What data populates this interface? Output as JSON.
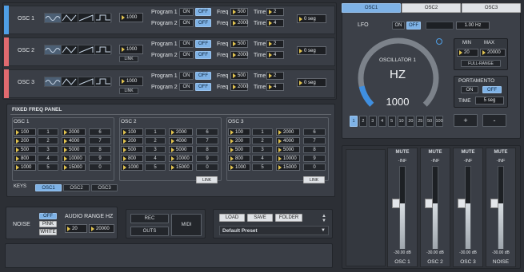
{
  "osc_rows": [
    {
      "label": "OSC 1",
      "accent": "#4f9fe6",
      "freq_value": "1000",
      "link": "",
      "prog1": "Program 1",
      "prog2": "Program 2",
      "on": "ON",
      "off": "OFF",
      "freq_label": "Freq",
      "time_label": "Time",
      "freq1": "500",
      "freq2": "2000",
      "time1": "2",
      "time2": "4",
      "seg": "0 seg"
    },
    {
      "label": "OSC 2",
      "accent": "#e06a6f",
      "freq_value": "1000",
      "link": "LINK",
      "prog1": "Program 1",
      "prog2": "Program 2",
      "on": "ON",
      "off": "OFF",
      "freq_label": "Freq",
      "time_label": "Time",
      "freq1": "500",
      "freq2": "2000",
      "time1": "2",
      "time2": "4",
      "seg": "0 seg"
    },
    {
      "label": "OSC 3",
      "accent": "#e06a6f",
      "freq_value": "1000",
      "link": "LINK",
      "prog1": "Program 1",
      "prog2": "Program 2",
      "on": "ON",
      "off": "OFF",
      "freq_label": "Freq",
      "time_label": "Time",
      "freq1": "500",
      "freq2": "2000",
      "time1": "2",
      "time2": "4",
      "seg": "0 seg"
    }
  ],
  "fixed_panel": {
    "title": "FIXED FREQ PANEL",
    "groups": [
      {
        "label": "OSC 1",
        "rows": [
          [
            "100",
            "1",
            "2000",
            "6"
          ],
          [
            "200",
            "2",
            "4000",
            "7"
          ],
          [
            "500",
            "3",
            "5000",
            "8"
          ],
          [
            "800",
            "4",
            "10000",
            "9"
          ],
          [
            "1000",
            "5",
            "15000",
            "0"
          ]
        ],
        "link": ""
      },
      {
        "label": "OSC 2",
        "rows": [
          [
            "100",
            "1",
            "2000",
            "6"
          ],
          [
            "200",
            "2",
            "4000",
            "7"
          ],
          [
            "500",
            "3",
            "5000",
            "8"
          ],
          [
            "800",
            "4",
            "10000",
            "9"
          ],
          [
            "1000",
            "5",
            "15000",
            "0"
          ]
        ],
        "link": "LINK"
      },
      {
        "label": "OSC 3",
        "rows": [
          [
            "100",
            "1",
            "2000",
            "6"
          ],
          [
            "200",
            "2",
            "4000",
            "7"
          ],
          [
            "500",
            "3",
            "5000",
            "8"
          ],
          [
            "800",
            "4",
            "10000",
            "9"
          ],
          [
            "1000",
            "5",
            "15000",
            "0"
          ]
        ],
        "link": "LINK"
      }
    ],
    "keys_label": "KEYS",
    "keys_tabs": [
      "OSC1",
      "OSC2",
      "OSC3"
    ]
  },
  "noise": {
    "label": "NOISE",
    "options": [
      "OFF",
      "PINK",
      "WHITE"
    ],
    "audio_range_label": "AUDIO RANGE HZ",
    "min": "20",
    "max": "20000"
  },
  "routing": {
    "rec": "REC",
    "outs": "OUTS",
    "midi": "MIDI"
  },
  "preset": {
    "load": "LOAD",
    "save": "SAVE",
    "folder": "FOLDER",
    "current": "Default Preset"
  },
  "tabs": [
    "OSC1",
    "OSC2",
    "OSC3"
  ],
  "lfo": {
    "label": "LFO",
    "on": "ON",
    "off": "OFF",
    "rate": "1.00 Hz"
  },
  "knob": {
    "title": "OSCILLATOR 1",
    "unit": "HZ",
    "value": "1000",
    "level": 0.12
  },
  "minmax": {
    "min_label": "MIN",
    "max_label": "MAX",
    "min": "20",
    "max": "20000",
    "full_range": "FULL-RANGE"
  },
  "portamento": {
    "label": "PORTAMENTO",
    "on": "ON",
    "off": "OFF",
    "time_label": "TIME",
    "time": "5 seg"
  },
  "multipliers": [
    "1",
    "2",
    "3",
    "4",
    "5",
    "10",
    "20",
    "25",
    "50",
    "100"
  ],
  "plus": "+",
  "minus": "-",
  "mixer": [
    {
      "mute": "MUTE",
      "peak": "-INF",
      "db": "-30.00 dB",
      "name": "OSC 1",
      "level": 0.55
    },
    {
      "mute": "MUTE",
      "peak": "-INF",
      "db": "-30.00 dB",
      "name": "OSC 2",
      "level": 0.55
    },
    {
      "mute": "MUTE",
      "peak": "-INF",
      "db": "-30.00 dB",
      "name": "OSC 3",
      "level": 0.55
    },
    {
      "mute": "MUTE",
      "peak": "-INF",
      "db": "-30.00 dB",
      "name": "NOISE",
      "level": 0.55
    }
  ]
}
